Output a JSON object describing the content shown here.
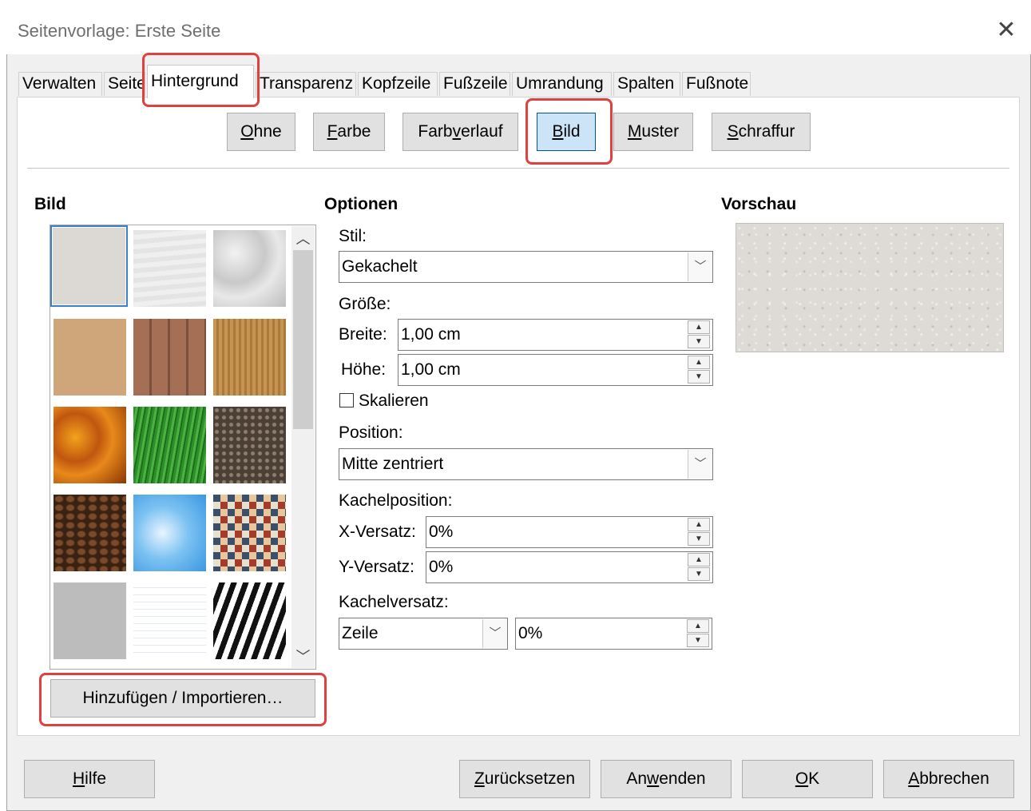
{
  "window": {
    "title": "Seitenvorlage: Erste Seite"
  },
  "tabs": [
    {
      "label": "Verwalten"
    },
    {
      "label": "Seite"
    },
    {
      "label": "Hintergrund"
    },
    {
      "label": "Transparenz"
    },
    {
      "label": "Kopfzeile"
    },
    {
      "label": "Fußzeile"
    },
    {
      "label": "Umrandung"
    },
    {
      "label": "Spalten"
    },
    {
      "label": "Fußnote"
    }
  ],
  "fill_buttons": {
    "none": {
      "pre": "",
      "key": "O",
      "post": "hne"
    },
    "color": {
      "pre": "",
      "key": "F",
      "post": "arbe"
    },
    "gradient": {
      "pre": "Farb",
      "key": "v",
      "post": "erlauf"
    },
    "image": {
      "pre": "",
      "key": "B",
      "post": "ild"
    },
    "pattern": {
      "pre": "",
      "key": "M",
      "post": "uster"
    },
    "hatch": {
      "pre": "",
      "key": "S",
      "post": "chraffur"
    }
  },
  "image_section": {
    "header": "Bild",
    "add_button": "Hinzufügen / Importieren…",
    "thumbnails": [
      "painted-white",
      "paper-texture",
      "paper-crumpled",
      "paper",
      "wooden-board",
      "fence",
      "autumn-leaves",
      "grass",
      "pebbles",
      "coffee-beans",
      "clouds",
      "color-stripes",
      "concrete",
      "invoice-paper",
      "zebra"
    ]
  },
  "options": {
    "header": "Optionen",
    "style_label": "Stil:",
    "style_value": "Gekachelt",
    "size_label": "Größe:",
    "width_label": "Breite:",
    "width_value": "1,00 cm",
    "height_label": "Höhe:",
    "height_value": "1,00 cm",
    "scale_label": "Skalieren",
    "position_label": "Position:",
    "position_value": "Mitte zentriert",
    "tile_position_label": "Kachelposition:",
    "x_offset_label": "X-Versatz:",
    "x_offset_value": "0%",
    "y_offset_label": "Y-Versatz:",
    "y_offset_value": "0%",
    "tile_offset_label": "Kachelversatz:",
    "tile_offset_mode": "Zeile",
    "tile_offset_value": "0%"
  },
  "preview": {
    "header": "Vorschau"
  },
  "footer": {
    "help": {
      "pre": "",
      "key": "H",
      "post": "ilfe"
    },
    "reset": {
      "pre": "",
      "key": "Z",
      "post": "urücksetzen"
    },
    "apply": {
      "pre": "An",
      "key": "w",
      "post": "enden"
    },
    "ok": {
      "pre": "",
      "key": "O",
      "post": "K"
    },
    "cancel": {
      "pre": "",
      "key": "A",
      "post": "bbrechen"
    }
  },
  "colors": {
    "highlight": "#e0403e",
    "selected_button": "#cce4f7",
    "selected_border": "#005499"
  }
}
